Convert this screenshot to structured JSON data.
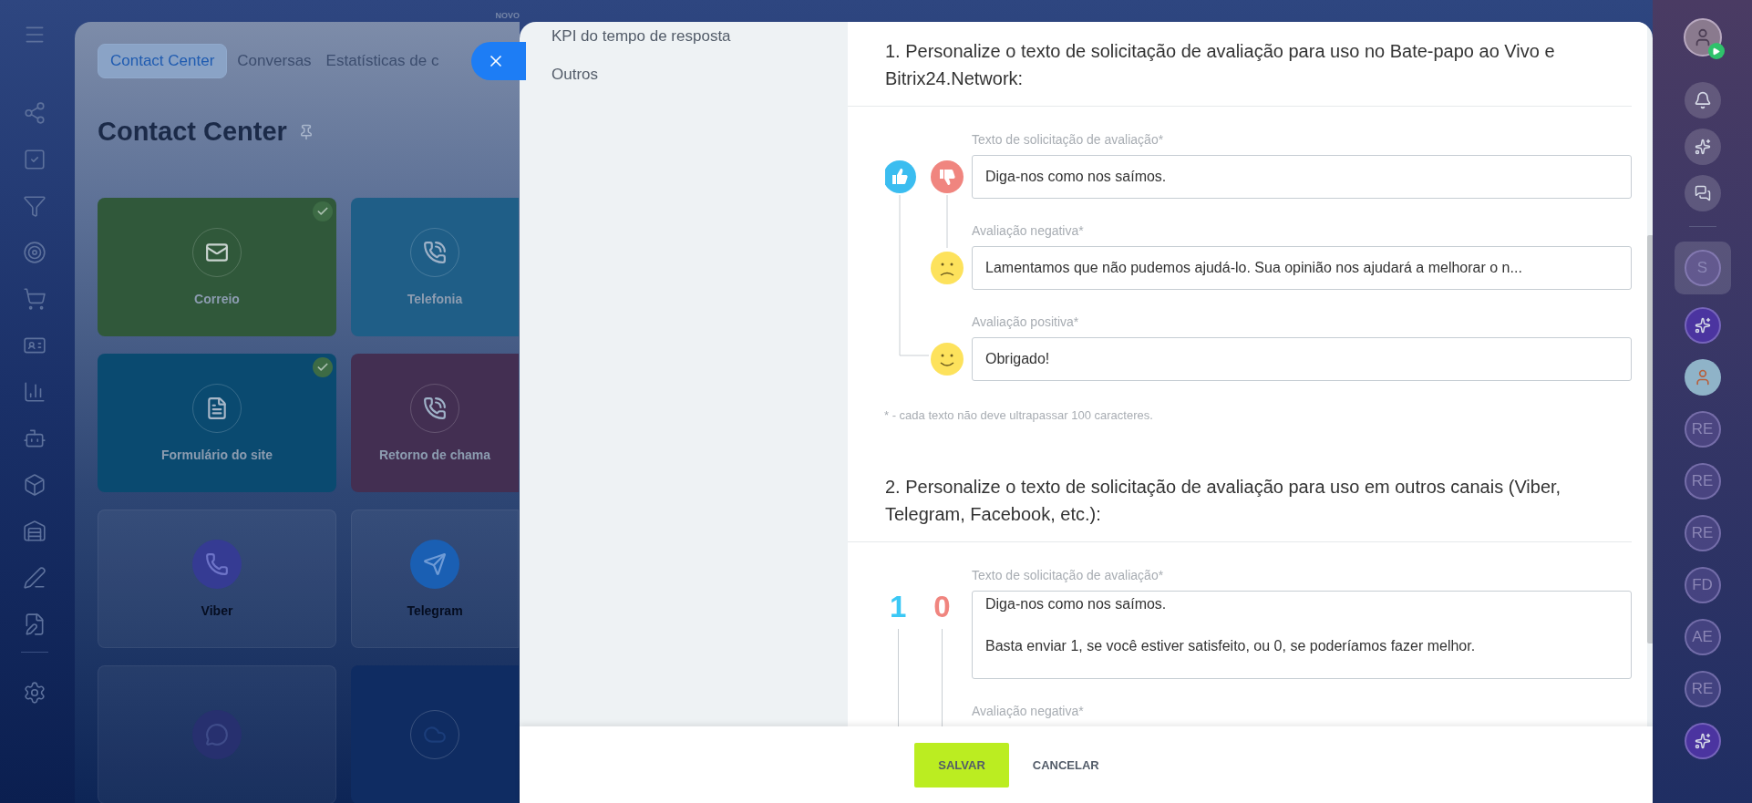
{
  "background_page": {
    "badge": "NOVO",
    "tabs": [
      {
        "label": "Contact Center",
        "selected": true
      },
      {
        "label": "Conversas",
        "selected": false
      },
      {
        "label": "Estatísticas de c",
        "selected": false
      }
    ],
    "title": "Contact Center",
    "tiles": [
      {
        "label": "Correio",
        "kind": "mail",
        "color": "#30583a",
        "connected": true
      },
      {
        "label": "Telefonia",
        "kind": "phone",
        "color": "#1f5e87",
        "connected": false
      },
      {
        "label": "Formulário do site",
        "kind": "form",
        "color": "#0a4a70",
        "connected": true
      },
      {
        "label": "Retorno de chama",
        "kind": "phone",
        "color": "#432f52",
        "connected": false
      },
      {
        "label": "Viber",
        "kind": "viber",
        "connected": false
      },
      {
        "label": "Telegram",
        "kind": "telegram",
        "connected": false
      },
      {
        "kind": "chat"
      },
      {
        "kind": "cloud",
        "color": "#0f2c62"
      }
    ]
  },
  "panel": {
    "nav": [
      {
        "label": "KPI do tempo de resposta"
      },
      {
        "label": "Outros"
      }
    ],
    "sections": [
      {
        "kind": "emoji",
        "title": "1. Personalize o texto de solicitação de avaliação para uso no Bate-papo ao Vivo e Bitrix24.Network:",
        "fields": [
          {
            "kind": "request",
            "label": "Texto de solicitação de avaliação*",
            "value": "Diga-nos como nos saímos."
          },
          {
            "kind": "negative",
            "label": "Avaliação negativa*",
            "value": "Lamentamos que não pudemos ajudá-lo. Sua opinião nos ajudará a melhorar o n..."
          },
          {
            "kind": "positive",
            "label": "Avaliação positiva*",
            "value": "Obrigado!"
          }
        ],
        "note": "* - cada texto não deve ultrapassar 100 caracteres."
      },
      {
        "kind": "digits",
        "title": "2. Personalize o texto de solicitação de avaliação para uso em outros canais (Viber, Telegram, Facebook, etc.):",
        "marks": [
          {
            "text": "1",
            "color": "#3bc8f5"
          },
          {
            "text": "0",
            "color": "#f0857f"
          }
        ],
        "fields": [
          {
            "label": "Texto de solicitação de avaliação*",
            "value": "Diga-nos como nos saímos.\n\nBasta enviar 1, se você estiver satisfeito, ou 0, se poderíamos fazer melhor."
          },
          {
            "label": "Avaliação negativa*"
          }
        ]
      }
    ],
    "buttons": [
      {
        "label": "SALVAR",
        "kind": "primary"
      },
      {
        "label": "CANCELAR",
        "kind": "link"
      }
    ]
  },
  "right_bar": {
    "items": [
      {
        "kind": "avatar",
        "selected": false
      },
      {
        "kind": "bell",
        "selected": false
      },
      {
        "kind": "ring",
        "selected": false
      },
      {
        "kind": "chat",
        "selected": false
      },
      {
        "kind": "initials",
        "text": "S",
        "selected": true
      },
      {
        "kind": "copilot",
        "selected": false
      },
      {
        "kind": "photo",
        "selected": false
      },
      {
        "kind": "initials",
        "text": "RE",
        "selected": false
      },
      {
        "kind": "initials",
        "text": "RE",
        "selected": false
      },
      {
        "kind": "initials",
        "text": "RE",
        "selected": false
      },
      {
        "kind": "initials",
        "text": "FD",
        "selected": false
      },
      {
        "kind": "initials",
        "text": "AE",
        "selected": false
      },
      {
        "kind": "initials",
        "text": "RE",
        "selected": false
      },
      {
        "kind": "copilot",
        "selected": false
      }
    ]
  }
}
